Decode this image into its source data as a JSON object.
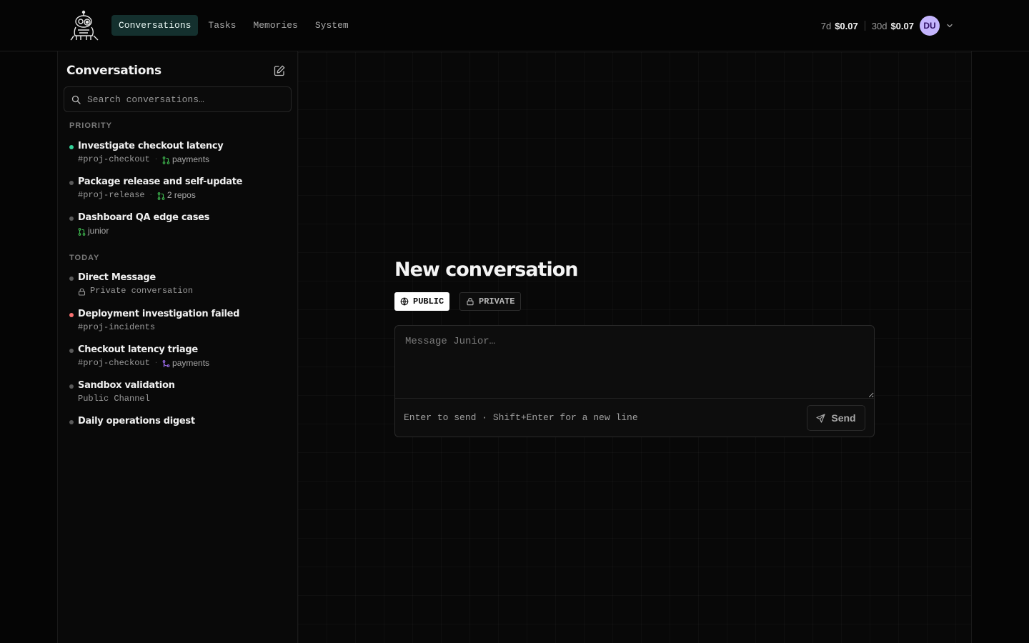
{
  "nav": {
    "items": [
      {
        "label": "Conversations",
        "active": true
      },
      {
        "label": "Tasks",
        "active": false
      },
      {
        "label": "Memories",
        "active": false
      },
      {
        "label": "System",
        "active": false
      }
    ]
  },
  "usage": {
    "week_label": "7d",
    "week_amount": "$0.07",
    "month_label": "30d",
    "month_amount": "$0.07",
    "avatar_initials": "DU"
  },
  "sidebar": {
    "title": "Conversations",
    "search_placeholder": "Search conversations…",
    "sections": [
      {
        "label": "PRIORITY",
        "items": [
          {
            "title": "Investigate checkout latency",
            "channel": "#proj-checkout",
            "repo": "payments",
            "status_color": "#34d399",
            "repo_icon": "pull-request-icon"
          },
          {
            "title": "Package release and self-update",
            "channel": "#proj-release",
            "repo": "2 repos",
            "status_color": "#5a5a5a",
            "repo_icon": "pull-request-icon"
          },
          {
            "title": "Dashboard QA edge cases",
            "channel": "",
            "repo": "junior",
            "status_color": "#5a5a5a",
            "repo_icon": "pull-request-icon"
          }
        ]
      },
      {
        "label": "TODAY",
        "items": [
          {
            "title": "Direct Message",
            "channel": "Private conversation",
            "repo": "",
            "status_color": "#5a5a5a",
            "private": true
          },
          {
            "title": "Deployment investigation failed",
            "channel": "#proj-incidents",
            "repo": "",
            "status_color": "#f87171"
          },
          {
            "title": "Checkout latency triage",
            "channel": "#proj-checkout",
            "repo": "payments",
            "status_color": "#5a5a5a",
            "repo_icon": "merge-icon"
          },
          {
            "title": "Sandbox validation",
            "channel": "Public Channel",
            "repo": "",
            "status_color": "#5a5a5a"
          },
          {
            "title": "Daily operations digest",
            "channel": "",
            "repo": "",
            "status_color": "#5a5a5a"
          }
        ]
      }
    ]
  },
  "main": {
    "title": "New conversation",
    "visibility": {
      "public_label": "PUBLIC",
      "private_label": "PRIVATE",
      "selected": "PUBLIC"
    },
    "composer": {
      "placeholder": "Message Junior…",
      "hint": "Enter to send · Shift+Enter for a new line",
      "send_label": "Send"
    }
  },
  "colors": {
    "accent_active_nav": "#14302e",
    "avatar_bg": "#c4b5fd",
    "status_green": "#34d399",
    "status_red": "#f87171",
    "pr_icon_green": "#3fb950",
    "merge_icon_purple": "#a371f7"
  }
}
